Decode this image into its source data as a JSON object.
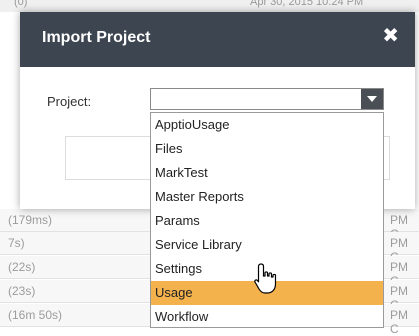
{
  "background": {
    "top_row": {
      "duration": "(0)",
      "timestamp": "Apr 30, 2015 10:24 PM"
    },
    "rows": [
      {
        "duration": "(179ms)",
        "suffix": "PM C"
      },
      {
        "duration": "7s)",
        "suffix": "PM C"
      },
      {
        "duration": "(22s)",
        "suffix": "PM C"
      },
      {
        "duration": "(23s)",
        "suffix": "PM C"
      },
      {
        "duration": "(16m 50s)",
        "suffix": "PM C"
      }
    ]
  },
  "dialog": {
    "title": "Import Project",
    "close_glyph": "✖",
    "project_label": "Project:",
    "selected_value": ""
  },
  "dropdown": {
    "options": [
      "ApptioUsage",
      "Files",
      "MarkTest",
      "Master Reports",
      "Params",
      "Service Library",
      "Settings",
      "Usage",
      "Workflow"
    ],
    "highlighted": "Usage"
  },
  "colors": {
    "header": "#3d4550",
    "highlight": "#f4b24d",
    "dropdown_arrow": "#4a4f56"
  },
  "cursor": {
    "icon": "hand-pointer-icon"
  }
}
